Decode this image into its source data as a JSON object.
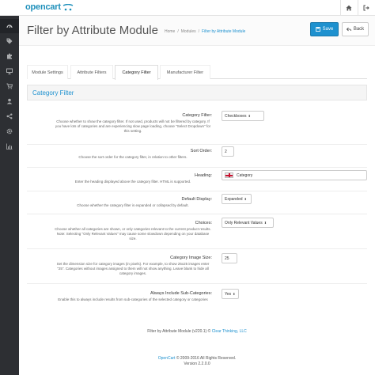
{
  "header": {
    "logo_text": "opencart",
    "home_icon": "home-icon",
    "logout_icon": "sign-out-icon"
  },
  "sidebar": {
    "items": [
      {
        "icon": "dashboard-icon"
      },
      {
        "icon": "tags-icon"
      },
      {
        "icon": "puzzle-icon"
      },
      {
        "icon": "desktop-icon"
      },
      {
        "icon": "cart-icon"
      },
      {
        "icon": "user-icon"
      },
      {
        "icon": "share-icon"
      },
      {
        "icon": "cog-icon"
      },
      {
        "icon": "bar-chart-icon"
      }
    ]
  },
  "page": {
    "title": "Filter by Attribute Module",
    "breadcrumb": [
      "Home",
      "Modules",
      "Filter by Attribute Module"
    ],
    "breadcrumb_sep": "/",
    "save_label": "Save",
    "back_label": "Back"
  },
  "tabs": [
    {
      "label": "Module Settings"
    },
    {
      "label": "Attribute Filters"
    },
    {
      "label": "Category Filter",
      "active": true
    },
    {
      "label": "Manufacturer Filter"
    }
  ],
  "panel": {
    "title": "Category Filter"
  },
  "form": {
    "category_filter": {
      "label": "Category Filter:",
      "help": "Choose whether to show the category filter. If not used, products will not be filtered by category. If you have lots of categories and are experiencing slow page loading, choose \"Select Dropdown\" for this setting.",
      "value": "Checkboxes"
    },
    "sort_order": {
      "label": "Sort Order:",
      "help": "Choose the sort order for the category filter, in relation to other filters.",
      "value": "2"
    },
    "heading": {
      "label": "Heading:",
      "help": "Enter the heading displayed above the category filter. HTML is supported.",
      "value": "Category"
    },
    "default_display": {
      "label": "Default Display:",
      "help": "Choose whether the category filter is expanded or collapsed by default.",
      "value": "Expanded"
    },
    "choices": {
      "label": "Choices:",
      "help": "Choose whether all categories are shown, or only categories relevant to the current product results. Note: Selecting \"Only Relevant Values\" may cause some slowdown depending on your database size.",
      "value": "Only Relevant Values"
    },
    "image_size": {
      "label": "Category Image Size:",
      "help": "Set the dimension size for category images (in pixels). For example, to show 25x25 images enter \"25\". Categories without images assigned to them will not show anything. Leave blank to hide all category images.",
      "value": "25"
    },
    "include_sub": {
      "label": "Always Include Sub-Categories:",
      "help": "Enable this to always include results from sub-categories of the selected category or categories",
      "value": "Yes"
    }
  },
  "module_footer": {
    "text": "Filter by Attribute Module (v220.1) ©",
    "link": "Clear Thinking, LLC"
  },
  "footer": {
    "link": "OpenCart",
    "copyright": "© 2009-2016 All Rights Reserved.",
    "version": "Version 2.2.0.0"
  }
}
